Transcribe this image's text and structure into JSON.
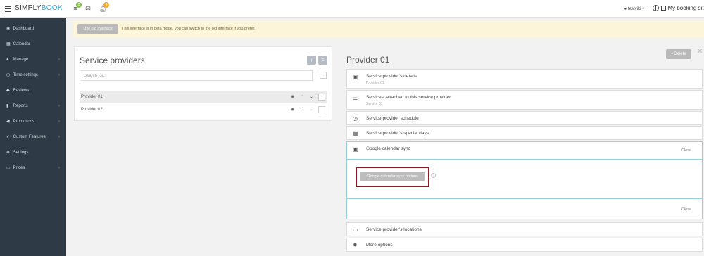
{
  "brand": {
    "part1": "SIMPLY",
    "part2": "BOOK"
  },
  "topbar": {
    "badge_tasks": "0",
    "badge_notifications": "3",
    "user": "testviki",
    "site": "My booking site"
  },
  "sidebar": {
    "items": [
      {
        "label": "Dashboard",
        "icon": "dashboard-icon",
        "arrow": ""
      },
      {
        "label": "Calendar",
        "icon": "calendar-icon",
        "arrow": ""
      },
      {
        "label": "Manage",
        "icon": "user-icon",
        "arrow": "‹"
      },
      {
        "label": "Time settings",
        "icon": "clock-icon",
        "arrow": "‹"
      },
      {
        "label": "Reviews",
        "icon": "comments-icon",
        "arrow": ""
      },
      {
        "label": "Reports",
        "icon": "bar-chart-icon",
        "arrow": "‹"
      },
      {
        "label": "Promotions",
        "icon": "bullhorn-icon",
        "arrow": "‹"
      },
      {
        "label": "Custom Features",
        "icon": "rocket-icon",
        "arrow": "‹"
      },
      {
        "label": "Settings",
        "icon": "gears-icon",
        "arrow": ""
      },
      {
        "label": "Prices",
        "icon": "money-icon",
        "arrow": "‹"
      }
    ]
  },
  "notice": {
    "button": "Use old interface",
    "text": "This interface is in beta mode, you can switch to the old interface if you prefer."
  },
  "providers_panel": {
    "title": "Service providers",
    "search_placeholder": "Search for...",
    "rows": [
      {
        "name": "Provider 01",
        "selected": true
      },
      {
        "name": "Provider 02",
        "selected": false
      }
    ]
  },
  "detail": {
    "title": "Provider 01",
    "delete_label": "Delete",
    "sections": [
      {
        "label": "Service provider's details",
        "sub": "Provider 01",
        "icon": "image-icon"
      },
      {
        "label": "Services, attached to this service provider",
        "sub": "Service 01",
        "icon": "list-icon"
      },
      {
        "label": "Service provider schedule",
        "sub": "",
        "icon": "clock-icon"
      },
      {
        "label": "Service provider's special days",
        "sub": "",
        "icon": "calendar-icon"
      },
      {
        "label": "Google calendar sync",
        "sub": "",
        "icon": "image-icon"
      }
    ],
    "close_label": "Close",
    "gcal_button": "Google calendar sync options",
    "help": "?",
    "footer_close": "Close",
    "after_sections": [
      {
        "label": "Service provider's locations",
        "icon": "folder-icon"
      },
      {
        "label": "More options",
        "icon": "gear-icon"
      }
    ]
  }
}
